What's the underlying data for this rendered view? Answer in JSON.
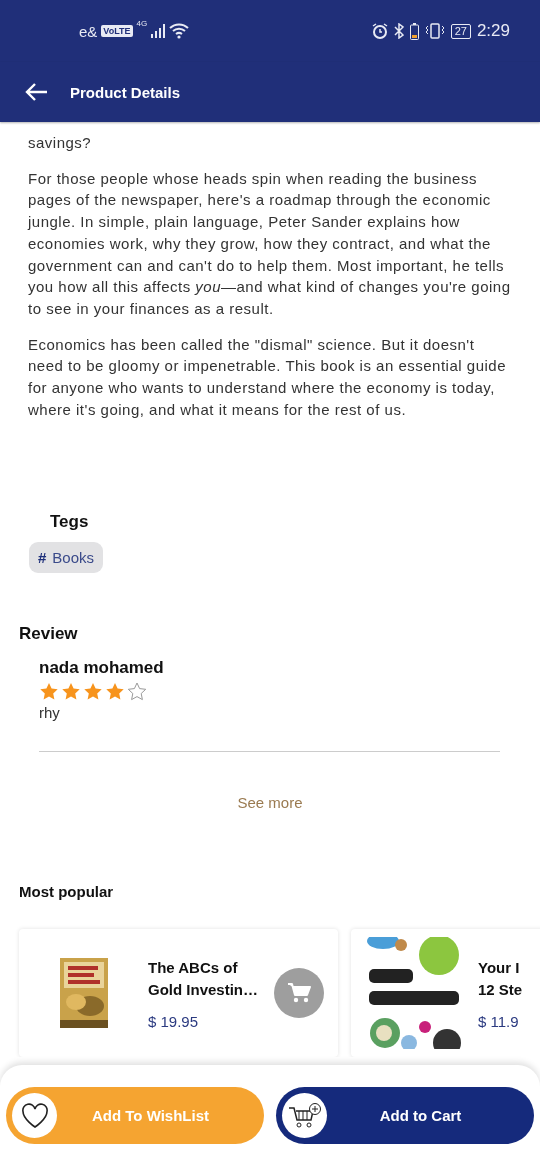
{
  "status_bar": {
    "carrier": "e&",
    "volte": "VoLTE",
    "network": "4G",
    "battery": "27",
    "time": "2:29"
  },
  "header": {
    "title": "Product Details"
  },
  "description": {
    "paragraphs": [
      "savings?",
      "For those people whose heads spin when reading the business pages of the newspaper, here's a roadmap through the economic jungle. In simple, plain language, Peter Sander explains how economies work, why they grow, how they contract, and what the government can and can't do to help them. Most important, he tells you how all this affects *you*—and what kind of changes you're going to see in your finances as a result.",
      "Economics has been called the \"dismal\" science. But it doesn't need to be gloomy or impenetrable. This book is an essential guide for anyone who wants to understand where the economy is today, where it's going, and what it means for the rest of us."
    ]
  },
  "tags": {
    "title": "Tegs",
    "items": [
      {
        "hash": "#",
        "label": "Books"
      }
    ]
  },
  "review": {
    "title": "Review",
    "items": [
      {
        "name": "nada mohamed",
        "stars": 4,
        "text": "rhy"
      }
    ],
    "see_more": "See more"
  },
  "most_popular": {
    "title": "Most popular",
    "items": [
      {
        "title_lines": [
          "The ABCs of",
          "Gold Investin…"
        ],
        "price": "$ 19.95",
        "cart_button": true
      },
      {
        "title_lines": [
          "Your I",
          "12 Ste"
        ],
        "price": "$ 11.9",
        "cart_button": false
      }
    ]
  },
  "actions": [
    {
      "kind": "wishlist",
      "label": "Add To WishList"
    },
    {
      "kind": "cart",
      "label": "Add to Cart"
    }
  ]
}
